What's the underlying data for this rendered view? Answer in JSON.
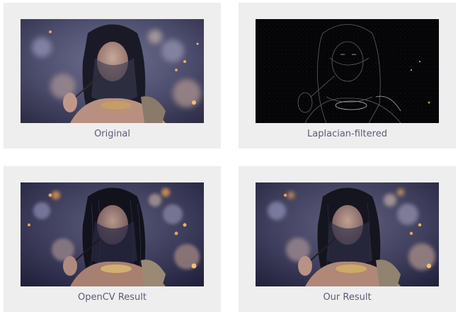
{
  "figures": [
    {
      "caption": "Original",
      "style": "original"
    },
    {
      "caption": "Laplacian-filtered",
      "style": "laplacian"
    },
    {
      "caption": "OpenCV Result",
      "style": "opencv"
    },
    {
      "caption": "Our Result",
      "style": "ours"
    }
  ],
  "colors": {
    "card_background": "#eeeeee",
    "caption_text": "#5b5b7a",
    "bokeh_warm": "#e8a060",
    "bokeh_cool": "#6a7aa0"
  }
}
